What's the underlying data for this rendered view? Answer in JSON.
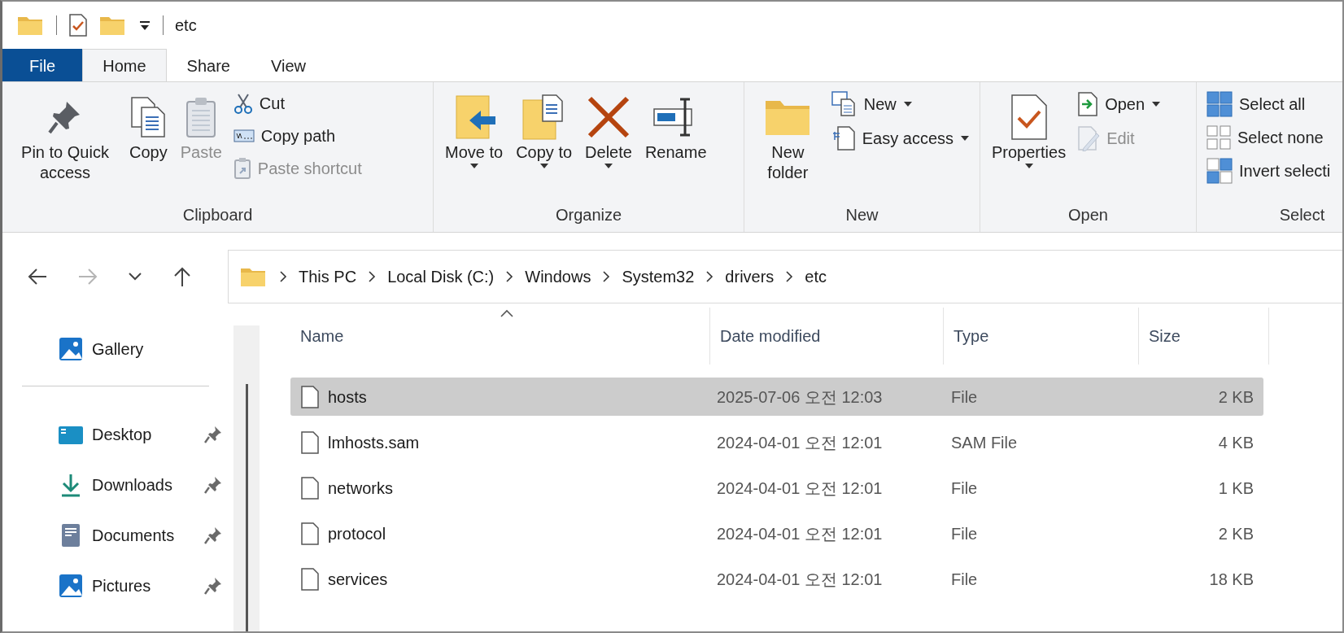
{
  "title_bar": {
    "title": "etc"
  },
  "ribbon": {
    "tabs": [
      {
        "label": "File",
        "kind": "file",
        "selected": false
      },
      {
        "label": "Home",
        "kind": "tab",
        "selected": true
      },
      {
        "label": "Share",
        "kind": "tab",
        "selected": false
      },
      {
        "label": "View",
        "kind": "tab",
        "selected": false
      }
    ],
    "groups": [
      {
        "label": "Clipboard",
        "items": [
          {
            "kind": "large",
            "label": "Pin to Quick access",
            "disabled": false,
            "dropdown": false
          },
          {
            "kind": "large",
            "label": "Copy",
            "disabled": false,
            "dropdown": false
          },
          {
            "kind": "large",
            "label": "Paste",
            "disabled": true,
            "dropdown": false
          },
          {
            "kind": "small",
            "label": "Cut",
            "disabled": false,
            "dropdown": false
          },
          {
            "kind": "small",
            "label": "Copy path",
            "disabled": false,
            "dropdown": false
          },
          {
            "kind": "small",
            "label": "Paste shortcut",
            "disabled": true,
            "dropdown": false
          }
        ]
      },
      {
        "label": "Organize",
        "items": [
          {
            "kind": "large",
            "label": "Move to",
            "disabled": false,
            "dropdown": true
          },
          {
            "kind": "large",
            "label": "Copy to",
            "disabled": false,
            "dropdown": true
          },
          {
            "kind": "large",
            "label": "Delete",
            "disabled": false,
            "dropdown": true
          },
          {
            "kind": "large",
            "label": "Rename",
            "disabled": false,
            "dropdown": false
          }
        ]
      },
      {
        "label": "New",
        "items": [
          {
            "kind": "large",
            "label": "New folder",
            "disabled": false,
            "dropdown": false
          },
          {
            "kind": "small",
            "label": "New",
            "disabled": false,
            "dropdown": true
          },
          {
            "kind": "small",
            "label": "Easy access",
            "disabled": false,
            "dropdown": true
          }
        ]
      },
      {
        "label": "Open",
        "items": [
          {
            "kind": "large",
            "label": "Properties",
            "disabled": false,
            "dropdown": true
          },
          {
            "kind": "small",
            "label": "Open",
            "disabled": false,
            "dropdown": true
          },
          {
            "kind": "small",
            "label": "Edit",
            "disabled": true,
            "dropdown": false
          }
        ]
      },
      {
        "label": "Select",
        "items": [
          {
            "kind": "small",
            "label": "Select all",
            "disabled": false,
            "dropdown": false
          },
          {
            "kind": "small",
            "label": "Select none",
            "disabled": false,
            "dropdown": false
          },
          {
            "kind": "small",
            "label": "Invert selecti",
            "disabled": false,
            "dropdown": false
          }
        ]
      }
    ]
  },
  "navigation": {
    "back": {
      "disabled": false
    },
    "forward": {
      "disabled": true
    },
    "up": {
      "disabled": false
    }
  },
  "address_bar": {
    "crumbs": [
      "This PC",
      "Local Disk (C:)",
      "Windows",
      "System32",
      "drivers",
      "etc"
    ]
  },
  "sidebar": {
    "items": [
      {
        "label": "Gallery",
        "kind": "gallery",
        "pinned": false
      },
      {
        "label": "Desktop",
        "kind": "desktop",
        "pinned": true
      },
      {
        "label": "Downloads",
        "kind": "downloads",
        "pinned": true
      },
      {
        "label": "Documents",
        "kind": "documents",
        "pinned": true
      },
      {
        "label": "Pictures",
        "kind": "pictures",
        "pinned": true
      }
    ]
  },
  "file_list": {
    "columns": [
      {
        "label": "Name",
        "sorted": true
      },
      {
        "label": "Date modified",
        "sorted": false
      },
      {
        "label": "Type",
        "sorted": false
      },
      {
        "label": "Size",
        "sorted": false
      }
    ],
    "rows": [
      {
        "name": "hosts",
        "date_modified": "2025-07-06 오전 12:03",
        "type": "File",
        "size": "2 KB",
        "selected": true
      },
      {
        "name": "lmhosts.sam",
        "date_modified": "2024-04-01 오전 12:01",
        "type": "SAM File",
        "size": "4 KB",
        "selected": false
      },
      {
        "name": "networks",
        "date_modified": "2024-04-01 오전 12:01",
        "type": "File",
        "size": "1 KB",
        "selected": false
      },
      {
        "name": "protocol",
        "date_modified": "2024-04-01 오전 12:01",
        "type": "File",
        "size": "2 KB",
        "selected": false
      },
      {
        "name": "services",
        "date_modified": "2024-04-01 오전 12:01",
        "type": "File",
        "size": "18 KB",
        "selected": false
      }
    ]
  }
}
